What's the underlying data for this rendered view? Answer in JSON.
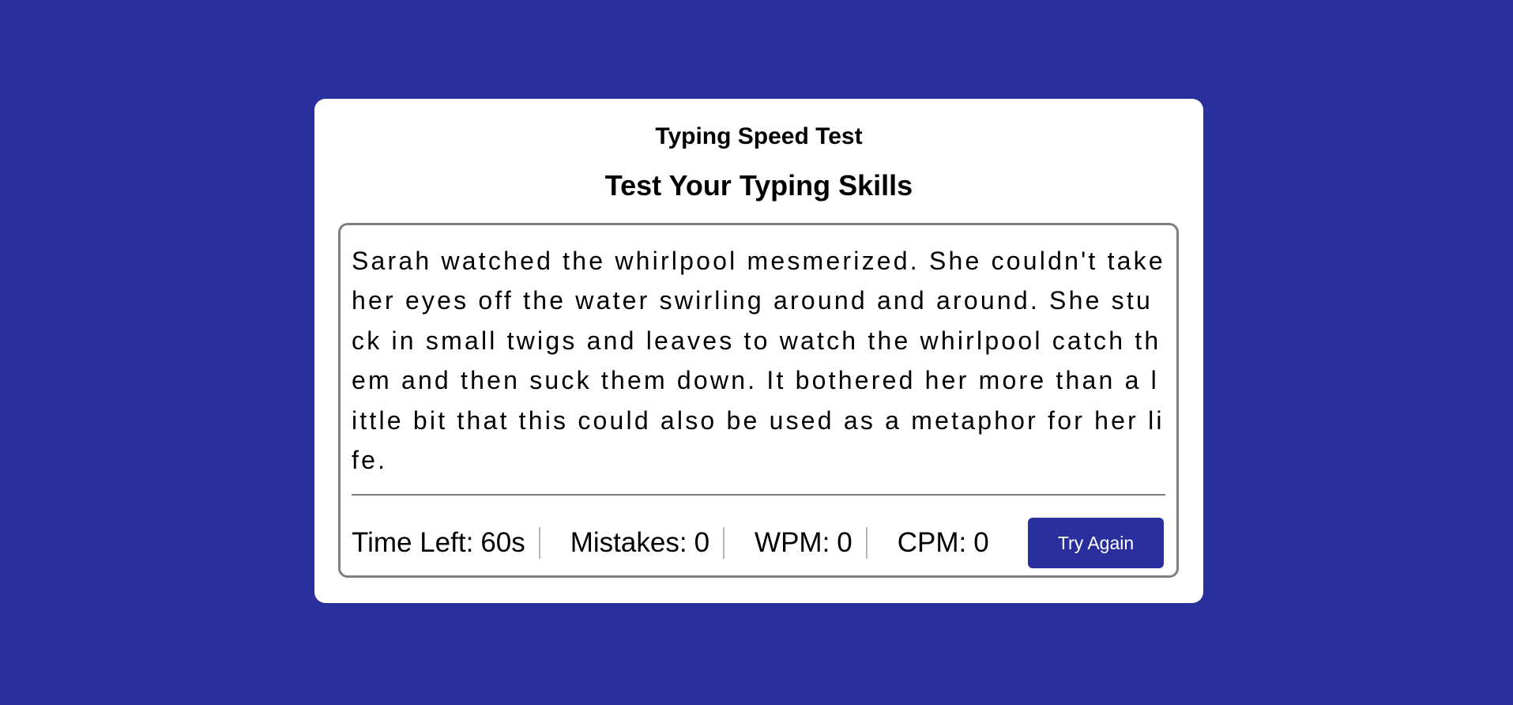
{
  "app": {
    "title": "Typing Speed Test",
    "subtitle": "Test Your Typing Skills"
  },
  "passage": {
    "text": "Sarah watched the whirlpool mesmerized. She couldn't take her eyes off the water swirling around and around. She stuck in small twigs and leaves to watch the whirlpool catch them and then suck them down. It bothered her more than a little bit that this could also be used as a metaphor for her life."
  },
  "stats": {
    "time_label": "Time Left:",
    "time_value": "60s",
    "mistakes_label": "Mistakes:",
    "mistakes_value": "0",
    "wpm_label": "WPM:",
    "wpm_value": "0",
    "cpm_label": "CPM:",
    "cpm_value": "0"
  },
  "actions": {
    "try_again_label": "Try Again"
  },
  "colors": {
    "background": "#2a2f9e",
    "card": "#ffffff",
    "border": "#7f7f7f",
    "button": "#2a2f9e",
    "button_text": "#ffffff"
  }
}
